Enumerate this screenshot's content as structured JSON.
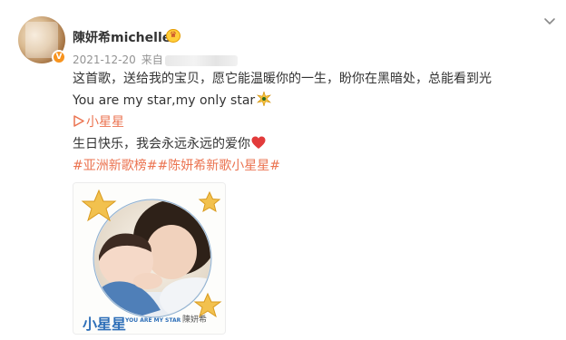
{
  "post": {
    "username": "陳妍希michelle",
    "date": "2021-12-20",
    "source_label": "来自",
    "verified_badge": "V",
    "crown_glyph": "♛",
    "line1": "这首歌，送给我的宝贝，愿它能温暖你的一生，盼你在黑暗处，总能看到光",
    "line2": "You are my star,my only star",
    "song_link": "小星星",
    "line4": "生日快乐，我会永远永远的爱你",
    "hashtags": "#亚洲新歌榜##陈妍希新歌小星星#"
  },
  "image": {
    "caption": "小星星",
    "subcaption": "YOU ARE MY STAR",
    "signature": "陳妍希"
  },
  "colors": {
    "link": "#eb7350",
    "text": "#333333",
    "meta": "#939393",
    "star": "#f2c14e",
    "caption_blue": "#2e6fb8"
  },
  "icons": {
    "menu": "chevron-down-icon",
    "emoji_1": "sparkle-icon",
    "emoji_2": "red-heart-icon",
    "link": "play-icon"
  }
}
